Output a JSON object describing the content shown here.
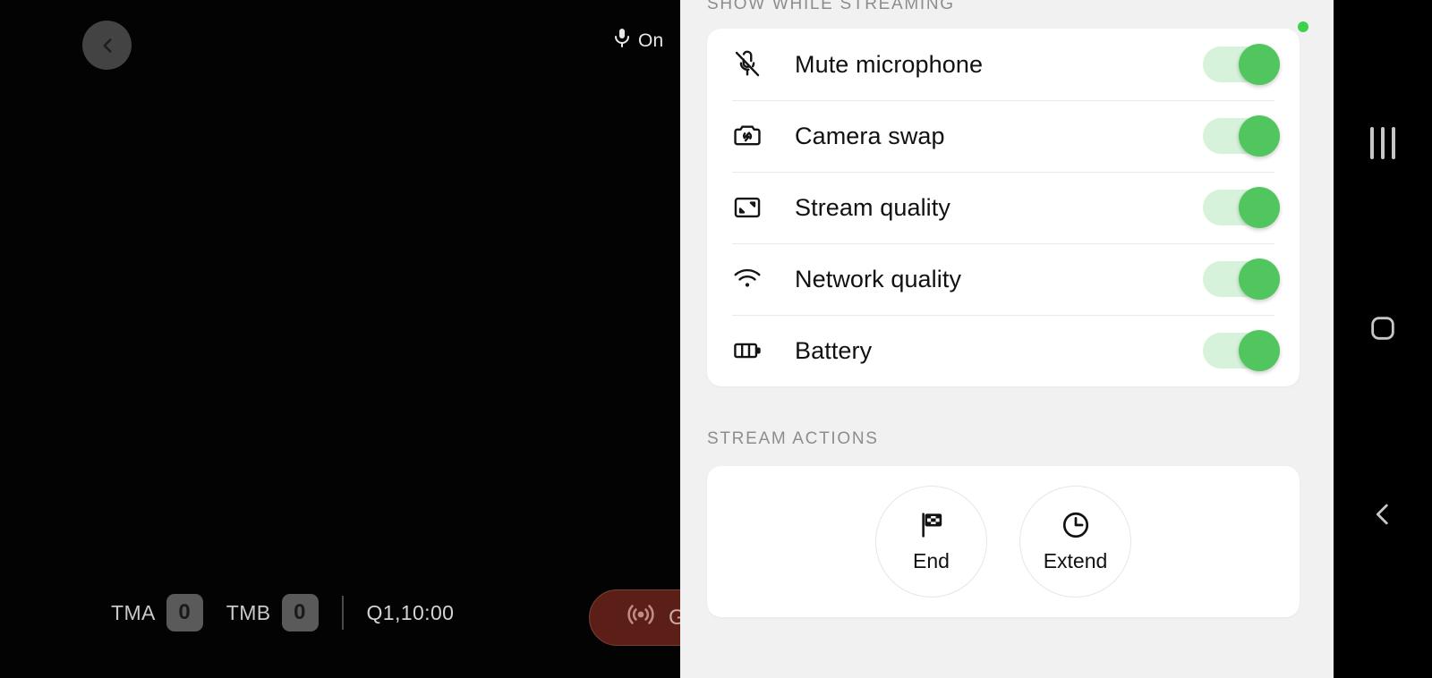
{
  "video": {
    "back_button": "back-chevron",
    "mic": {
      "icon": "microphone-icon",
      "status": "On"
    },
    "scoreboard": {
      "team_a_name": "TMA",
      "team_a_score": "0",
      "team_b_name": "TMB",
      "team_b_score": "0",
      "clock": "Q1,10:00"
    },
    "live_button": {
      "icon": "broadcast-icon",
      "label": "G"
    }
  },
  "settings": {
    "sections": [
      {
        "header": "SHOW WHILE STREAMING",
        "rows": [
          {
            "icon": "mic-off-icon",
            "label": "Mute microphone",
            "enabled": true
          },
          {
            "icon": "camera-swap-icon",
            "label": "Camera swap",
            "enabled": true
          },
          {
            "icon": "stream-quality-icon",
            "label": "Stream quality",
            "enabled": true
          },
          {
            "icon": "wifi-icon",
            "label": "Network quality",
            "enabled": true
          },
          {
            "icon": "battery-icon",
            "label": "Battery",
            "enabled": true
          }
        ]
      },
      {
        "header": "STREAM ACTIONS",
        "actions": [
          {
            "icon": "checkered-flag-icon",
            "label": "End"
          },
          {
            "icon": "clock-icon",
            "label": "Extend"
          }
        ]
      }
    ],
    "status_indicator": "online-dot"
  },
  "nav_bar": {
    "recents": "recents-icon",
    "home": "home-icon",
    "back": "back-icon"
  },
  "colors": {
    "toggle_on_thumb": "#51c65f",
    "toggle_on_track": "#d6f2da",
    "panel_background": "#f1f1f1",
    "card_background": "#ffffff",
    "status_dot": "#3fd04e",
    "live_button": "#5c1f18"
  }
}
